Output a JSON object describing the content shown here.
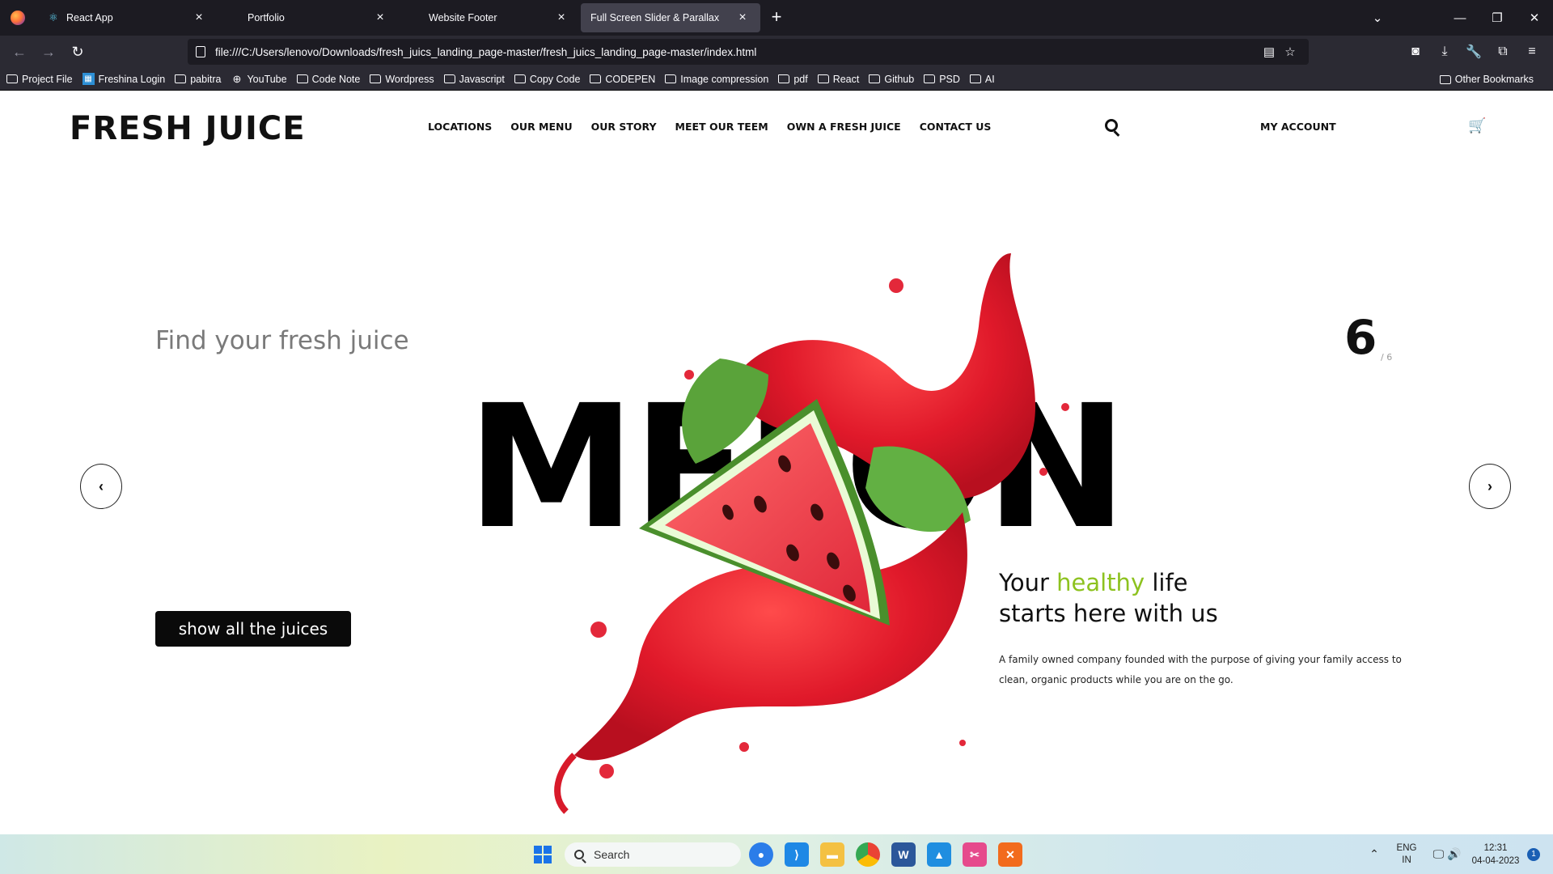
{
  "browser": {
    "tabs": [
      {
        "label": "React App",
        "active": false
      },
      {
        "label": "Portfolio",
        "active": false
      },
      {
        "label": "Website Footer",
        "active": false
      },
      {
        "label": "Full Screen Slider & Parallax",
        "active": true
      }
    ],
    "url": "file:///C:/Users/lenovo/Downloads/fresh_juics_landing_page-master/fresh_juics_landing_page-master/index.html",
    "bookmarks": [
      "Project File",
      "Freshina Login",
      "pabitra",
      "YouTube",
      "Code Note",
      "Wordpress",
      "Javascript",
      "Copy Code",
      "CODEPEN",
      "Image compression",
      "pdf",
      "React",
      "Github",
      "PSD",
      "AI"
    ],
    "other_bookmarks": "Other Bookmarks"
  },
  "site": {
    "logo": "FRESH JUICE",
    "nav": [
      "LOCATIONS",
      "OUR MENU",
      "OUR STORY",
      "MEET OUR TEEM",
      "OWN A FRESH JUICE",
      "CONTACT US"
    ],
    "account": "MY ACCOUNT",
    "tagline": "Find your fresh juice",
    "slide_word": "MELON",
    "slide_number": "6",
    "slide_total": "/ 6",
    "cta": "show all the juices",
    "headline_pre": "Your ",
    "headline_highlight": "healthy",
    "headline_mid": " life",
    "headline_line2": "starts here with us",
    "description": "A family owned company founded with the purpose of giving your family access to clean, organic products while you are on the go.",
    "accent_color": "#8dc21f"
  },
  "taskbar": {
    "search_placeholder": "Search",
    "lang_top": "ENG",
    "lang_bottom": "IN",
    "time": "12:31",
    "date": "04-04-2023",
    "notification_count": "1"
  }
}
